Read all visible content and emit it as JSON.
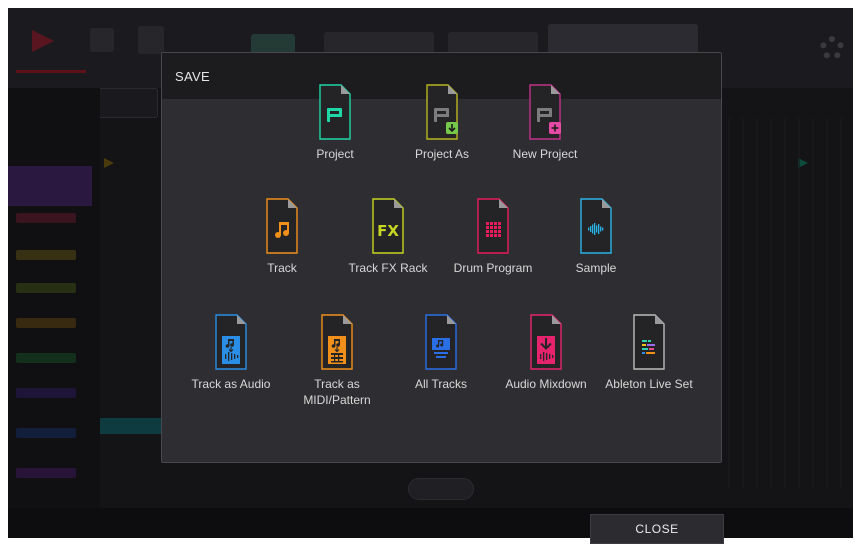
{
  "modal": {
    "title": "SAVE"
  },
  "items": [
    {
      "label": "Project",
      "icon": "project-file-icon",
      "color": "#1fd6a6",
      "glyph": "P",
      "badge": ""
    },
    {
      "label": "Project As",
      "icon": "project-as-file-icon",
      "color": "#b8b61f",
      "glyph": "P",
      "badge": "download"
    },
    {
      "label": "New Project",
      "icon": "new-project-file-icon",
      "color": "#c2328c",
      "glyph": "P",
      "badge": "plus"
    },
    {
      "label": "Track",
      "icon": "track-file-icon",
      "color": "#f0901a",
      "glyph": "♫"
    },
    {
      "label": "Track FX Rack",
      "icon": "track-fx-rack-file-icon",
      "color": "#c7d620",
      "glyph": "FX"
    },
    {
      "label": "Drum Program",
      "icon": "drum-program-file-icon",
      "color": "#e61c5c",
      "glyph": "grid"
    },
    {
      "label": "Sample",
      "icon": "sample-file-icon",
      "color": "#2ab4e6",
      "glyph": "wave"
    },
    {
      "label": "Track as Audio",
      "icon": "track-as-audio-file-icon",
      "color": "#2a8ee6",
      "glyph": "audio"
    },
    {
      "label": "Track as MIDI/Pattern",
      "icon": "track-as-midi-file-icon",
      "color": "#f0901a",
      "glyph": "midi"
    },
    {
      "label": "All Tracks",
      "icon": "all-tracks-file-icon",
      "color": "#2a6ee6",
      "glyph": "tracks"
    },
    {
      "label": "Audio Mixdown",
      "icon": "audio-mixdown-file-icon",
      "color": "#e6246e",
      "glyph": "mixdown"
    },
    {
      "label": "Ableton Live Set",
      "icon": "ableton-live-set-file-icon",
      "color": "#bbbbbb",
      "glyph": "lines"
    }
  ],
  "footer": {
    "close_label": "CLOSE"
  }
}
